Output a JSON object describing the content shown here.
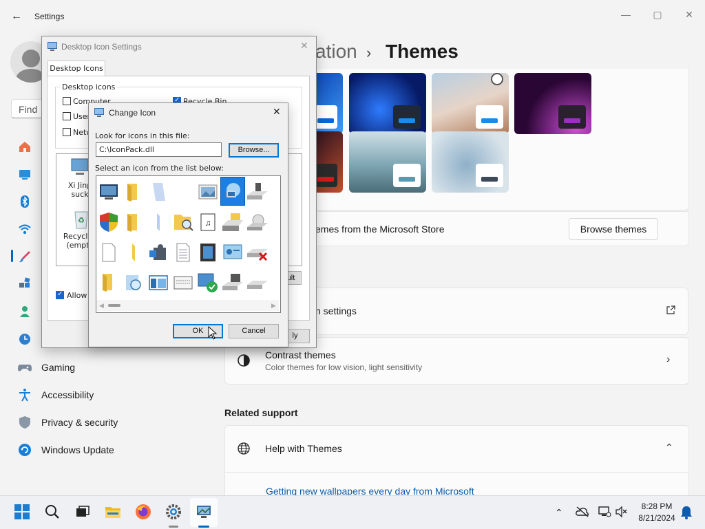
{
  "window": {
    "title": "Settings",
    "controls": [
      "—",
      "▢",
      "✕"
    ]
  },
  "search": {
    "placeholder": "Find a"
  },
  "nav": {
    "items": [
      {
        "label": "Gaming",
        "icon": "gamepad-icon"
      },
      {
        "label": "Accessibility",
        "icon": "accessibility-icon"
      },
      {
        "label": "Privacy & security",
        "icon": "shield-icon"
      },
      {
        "label": "Windows Update",
        "icon": "update-icon"
      }
    ]
  },
  "breadcrumb": {
    "partial": "ation",
    "separator": "›",
    "current": "Themes"
  },
  "themes": {
    "store_text": "emes from the Microsoft Store",
    "browse_label": "Browse themes"
  },
  "rows": {
    "icon_settings": "n settings",
    "contrast_title": "Contrast themes",
    "contrast_sub": "Color themes for low vision, light sensitivity"
  },
  "related": {
    "heading": "Related support",
    "help_title": "Help with Themes",
    "help_link": "Getting new wallpapers every day from Microsoft"
  },
  "desktop_icon_dialog": {
    "title": "Desktop Icon Settings",
    "tab": "Desktop Icons",
    "group": "Desktop icons",
    "checks": [
      "Computer",
      "User",
      "Netw",
      "Recycle Bin"
    ],
    "preview_1": "Xi Jinp suck",
    "preview_2": "Recycle (empt",
    "allow_label": "Allow t",
    "default_fragment": "ult",
    "apply_fragment": "ly"
  },
  "change_icon_dialog": {
    "title": "Change Icon",
    "look_label": "Look for icons in this file:",
    "path": "C:\\IconPack.dll",
    "browse": "Browse...",
    "select_label": "Select an icon from the list below:",
    "ok": "OK",
    "cancel": "Cancel"
  },
  "clock": {
    "time": "8:28 PM",
    "date": "8/21/2024"
  },
  "colors": {
    "accent": "#0067c0",
    "dialog_bg": "#f0f0f0"
  }
}
